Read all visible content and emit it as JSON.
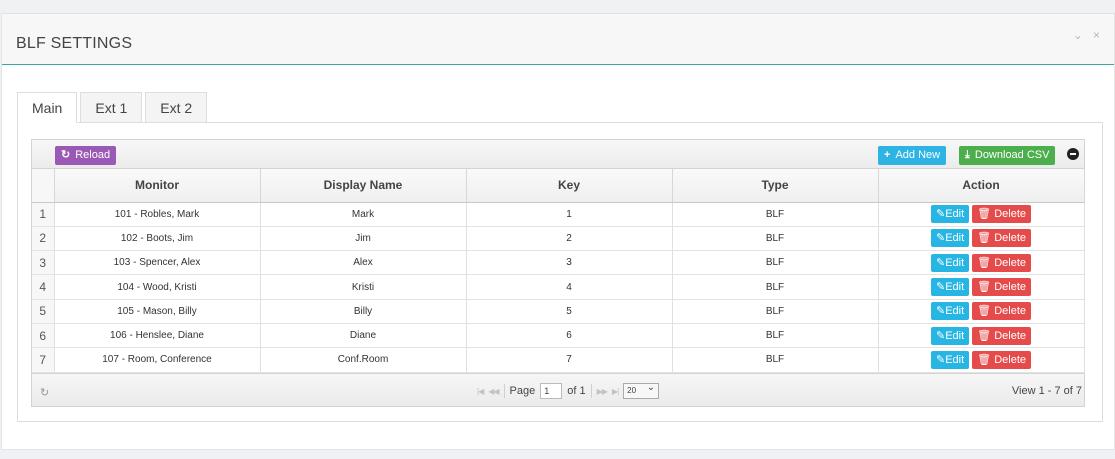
{
  "panel": {
    "title": "BLF SETTINGS",
    "collapse_icon": "⌄",
    "close_icon": "×"
  },
  "tabs": [
    {
      "label": "Main"
    },
    {
      "label": "Ext 1"
    },
    {
      "label": "Ext 2"
    }
  ],
  "toolbar": {
    "reload": "Reload",
    "add_new": "Add New",
    "download_csv": "Download CSV"
  },
  "table": {
    "columns": [
      "Monitor",
      "Display Name",
      "Key",
      "Type",
      "Action"
    ],
    "rows": [
      {
        "n": "1",
        "monitor": "101 - Robles, Mark",
        "display": "Mark",
        "key": "1",
        "type": "BLF"
      },
      {
        "n": "2",
        "monitor": "102 - Boots, Jim",
        "display": "Jim",
        "key": "2",
        "type": "BLF"
      },
      {
        "n": "3",
        "monitor": "103 - Spencer, Alex",
        "display": "Alex",
        "key": "3",
        "type": "BLF"
      },
      {
        "n": "4",
        "monitor": "104 - Wood, Kristi",
        "display": "Kristi",
        "key": "4",
        "type": "BLF"
      },
      {
        "n": "5",
        "monitor": "105 - Mason, Billy",
        "display": "Billy",
        "key": "5",
        "type": "BLF"
      },
      {
        "n": "6",
        "monitor": "106 - Henslee, Diane",
        "display": "Diane",
        "key": "6",
        "type": "BLF"
      },
      {
        "n": "7",
        "monitor": "107 - Room, Conference",
        "display": "Conf.Room",
        "key": "7",
        "type": "BLF"
      }
    ],
    "edit_label": "Edit",
    "delete_label": "Delete"
  },
  "pager": {
    "page_label": "Page",
    "page_value": "1",
    "of_label": "of 1",
    "rows_per_page": "20",
    "view": "View 1 - 7 of 7"
  },
  "colors": {
    "accent": "#3aa99a",
    "reload": "#9b59b6",
    "add": "#2db4e5",
    "csv": "#4cae4c",
    "edit": "#27b6e3",
    "delete": "#e54b4b"
  }
}
